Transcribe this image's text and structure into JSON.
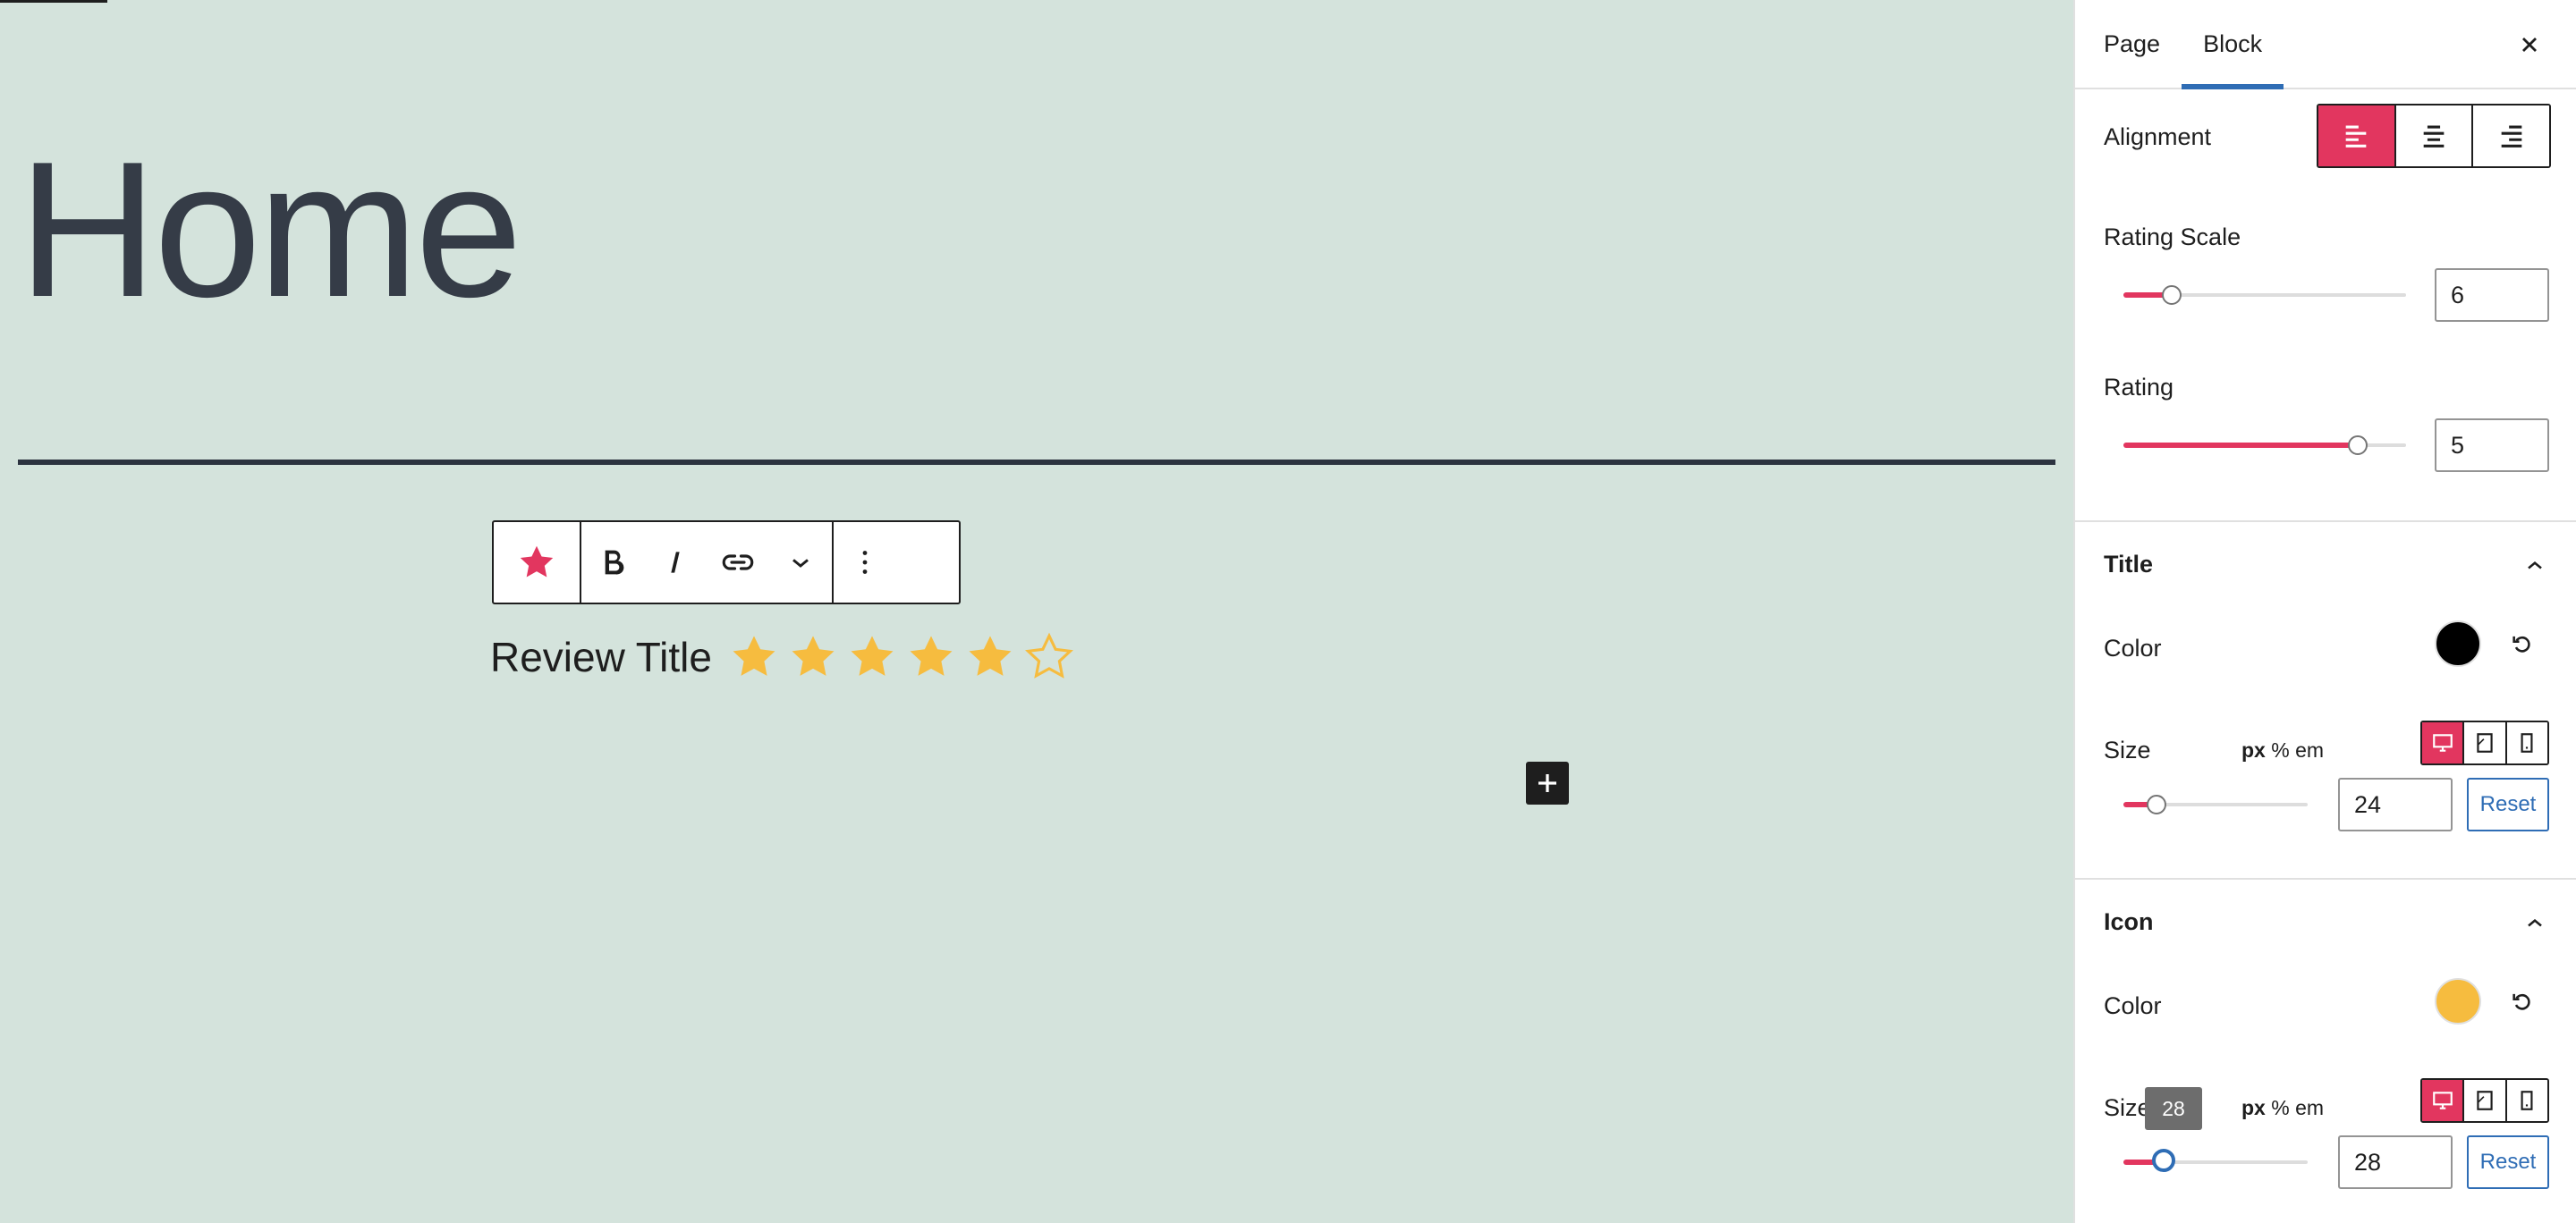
{
  "canvas": {
    "page_title": "Home",
    "background_color": "#d4e3dc",
    "review": {
      "title": "Review Title",
      "rating": 5,
      "rating_scale": 6,
      "star_color": "#f6bc3f"
    }
  },
  "block_toolbar": {
    "items": [
      "star-block-icon",
      "bold-icon",
      "italic-icon",
      "link-icon",
      "chevron-down-icon",
      "more-options-icon"
    ],
    "accent": "#e2365f"
  },
  "sidebar": {
    "tabs": [
      {
        "label": "Page",
        "active": false
      },
      {
        "label": "Block",
        "active": true
      }
    ],
    "alignment": {
      "label": "Alignment",
      "selected": "left",
      "options": [
        "align-left-icon",
        "align-center-icon",
        "align-right-icon"
      ]
    },
    "rating_scale": {
      "label": "Rating Scale",
      "value": "6",
      "slider_fraction": 0.17
    },
    "rating": {
      "label": "Rating",
      "value": "5",
      "slider_fraction": 0.83
    },
    "title_panel": {
      "title": "Title",
      "color_label": "Color",
      "color": "#000000",
      "size_label": "Size",
      "units": [
        "px",
        "%",
        "em"
      ],
      "selected_unit": "px",
      "size_value": "24",
      "size_slider_fraction": 0.18,
      "reset_label": "Reset"
    },
    "icon_panel": {
      "title": "Icon",
      "color_label": "Color",
      "color": "#f6bc3f",
      "size_label": "Size",
      "units": [
        "px",
        "%",
        "em"
      ],
      "selected_unit": "px",
      "size_value": "28",
      "size_slider_fraction": 0.22,
      "tooltip": "28",
      "reset_label": "Reset"
    }
  }
}
